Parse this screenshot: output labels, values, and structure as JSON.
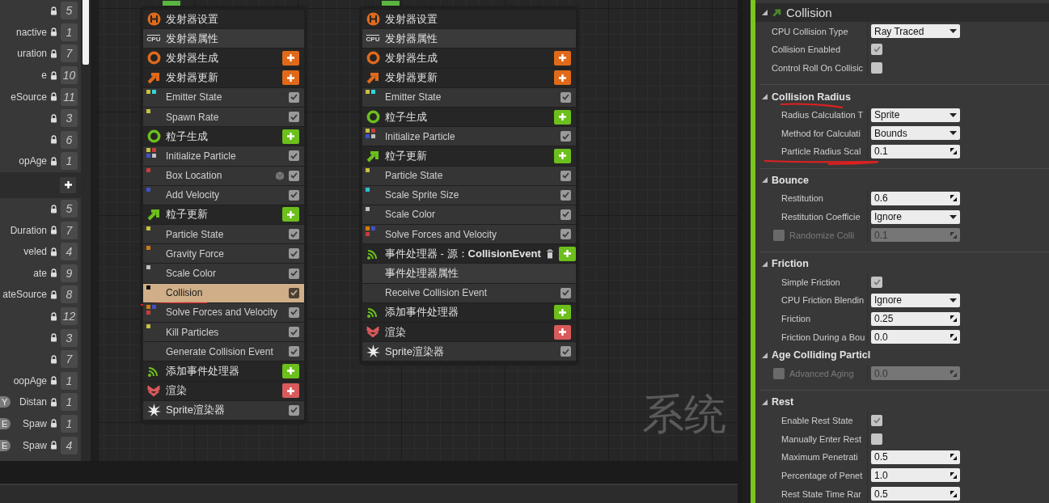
{
  "parameters": {
    "rows": [
      {
        "kind": "param",
        "count": "5"
      },
      {
        "kind": "param",
        "name": "nactive",
        "count": "1"
      },
      {
        "kind": "param",
        "name": "uration",
        "count": "7"
      },
      {
        "kind": "param",
        "name": "e",
        "count": "10"
      },
      {
        "kind": "param",
        "name": "eSource",
        "count": "11"
      },
      {
        "kind": "param",
        "count": "3"
      },
      {
        "kind": "param",
        "count": "6"
      },
      {
        "kind": "param",
        "name": "opAge",
        "count": "1"
      },
      {
        "kind": "header"
      },
      {
        "kind": "param",
        "count": "5"
      },
      {
        "kind": "param",
        "name": "Duration",
        "count": "7"
      },
      {
        "kind": "param",
        "name": "veled",
        "count": "4"
      },
      {
        "kind": "param",
        "name": "ate",
        "count": "9"
      },
      {
        "kind": "param",
        "name": "ateSource",
        "count": "8"
      },
      {
        "kind": "param",
        "count": "12"
      },
      {
        "kind": "param",
        "count": "3"
      },
      {
        "kind": "param",
        "count": "7"
      },
      {
        "kind": "param",
        "name": "oopAge",
        "count": "1"
      },
      {
        "kind": "param",
        "badge": "Y",
        "name": "Distan",
        "count": "1"
      },
      {
        "kind": "param",
        "badge": "E",
        "name": "Spaw",
        "count": "1"
      },
      {
        "kind": "param",
        "badge": "E",
        "name": "Spaw",
        "count": "4"
      }
    ]
  },
  "graph": {
    "label": "系统",
    "nodes": [
      {
        "items": [
          {
            "kind": "settings",
            "label": "发射器设置",
            "color": "#e06a1a",
            "add": false
          },
          {
            "kind": "props",
            "badge": "CPU",
            "label": "发射器属性"
          },
          {
            "kind": "spawn",
            "label": "发射器生成",
            "color": "#e06a1a",
            "add": true
          },
          {
            "kind": "update",
            "label": "发射器更新",
            "color": "#e06a1a",
            "add": true
          },
          {
            "kind": "module",
            "label": "Emitter State",
            "dots": [
              {
                "color": "#c8c040"
              },
              {
                "color": "#30d8d8"
              }
            ],
            "checked": true,
            "selected": false
          },
          {
            "kind": "module",
            "label": "Spawn Rate",
            "dots": [
              {
                "color": "#c8c040"
              }
            ],
            "checked": true,
            "selected": false
          },
          {
            "kind": "spawn",
            "label": "粒子生成",
            "color": "#6cbf1c",
            "add": true
          },
          {
            "kind": "module",
            "label": "Initialize Particle",
            "dots": [
              {
                "color": "#c8c040"
              },
              {
                "color": "#c83c3c"
              },
              {
                "color": "#4050c8"
              },
              {
                "color": "#c0c0c0"
              }
            ],
            "checked": true,
            "selected": false
          },
          {
            "kind": "module",
            "label": "Box Location",
            "dots": [
              {
                "color": "#c83c3c"
              }
            ],
            "checked": true,
            "selected": false,
            "cube": true
          },
          {
            "kind": "module",
            "label": "Add Velocity",
            "dots": [
              {
                "color": "#4050c8"
              }
            ],
            "checked": true,
            "selected": false
          },
          {
            "kind": "update",
            "label": "粒子更新",
            "color": "#6cbf1c",
            "add": true
          },
          {
            "kind": "module",
            "label": "Particle State",
            "dots": [
              {
                "color": "#c8c040"
              }
            ],
            "checked": true,
            "selected": false
          },
          {
            "kind": "module",
            "label": "Gravity Force",
            "dots": [
              {
                "color": "#d07a10"
              }
            ],
            "checked": true,
            "selected": false
          },
          {
            "kind": "module",
            "label": "Scale Color",
            "dots": [
              {
                "color": "#c0c0c0"
              }
            ],
            "checked": true,
            "selected": false
          },
          {
            "kind": "module",
            "label": "Collision",
            "dots": [
              {
                "color": "#101010"
              }
            ],
            "checked": true,
            "selected": true,
            "annotated": true
          },
          {
            "kind": "module",
            "label": "Solve Forces and Velocity",
            "dots": [
              {
                "color": "#d07a10"
              },
              {
                "color": "#4050c8"
              },
              {
                "color": "#c83c3c"
              }
            ],
            "checked": true,
            "selected": false
          },
          {
            "kind": "module",
            "label": "Kill Particles",
            "dots": [
              {
                "color": "#c8c040"
              }
            ],
            "checked": true,
            "selected": false
          },
          {
            "kind": "module",
            "label": "Generate Collision Event",
            "checked": true,
            "selected": false
          },
          {
            "kind": "events",
            "label": "添加事件处理器",
            "color": "#6cbf1c",
            "add": true
          },
          {
            "kind": "render",
            "label": "渲染",
            "color": "#d85a5a",
            "add": true
          },
          {
            "kind": "renderer",
            "label": "Sprite渲染器",
            "checked": true
          }
        ]
      },
      {
        "items": [
          {
            "kind": "settings",
            "label": "发射器设置",
            "color": "#e06a1a",
            "add": false
          },
          {
            "kind": "props",
            "badge": "CPU",
            "label": "发射器属性"
          },
          {
            "kind": "spawn",
            "label": "发射器生成",
            "color": "#e06a1a",
            "add": true
          },
          {
            "kind": "update",
            "label": "发射器更新",
            "color": "#e06a1a",
            "add": true
          },
          {
            "kind": "module",
            "label": "Emitter State",
            "dots": [
              {
                "color": "#c8c040"
              },
              {
                "color": "#30d8d8"
              }
            ],
            "checked": true,
            "selected": false
          },
          {
            "kind": "spawn",
            "label": "粒子生成",
            "color": "#6cbf1c",
            "add": true
          },
          {
            "kind": "module",
            "label": "Initialize Particle",
            "dots": [
              {
                "color": "#c8c040"
              },
              {
                "color": "#c83c3c"
              },
              {
                "color": "#4050c8"
              },
              {
                "color": "#c0c0c0"
              }
            ],
            "checked": true,
            "selected": false
          },
          {
            "kind": "update",
            "label": "粒子更新",
            "color": "#6cbf1c",
            "add": true
          },
          {
            "kind": "module",
            "label": "Particle State",
            "dots": [
              {
                "color": "#c8c040"
              }
            ],
            "checked": true,
            "selected": false
          },
          {
            "kind": "module",
            "label": "Scale Sprite Size",
            "dots": [
              {
                "color": "#30c0d0"
              }
            ],
            "checked": true,
            "selected": false
          },
          {
            "kind": "module",
            "label": "Scale Color",
            "dots": [
              {
                "color": "#c0c0c0"
              }
            ],
            "checked": true,
            "selected": false
          },
          {
            "kind": "module",
            "label": "Solve Forces and Velocity",
            "dots": [
              {
                "color": "#d07a10"
              },
              {
                "color": "#4050c8"
              },
              {
                "color": "#c83c3c"
              }
            ],
            "checked": true,
            "selected": false
          },
          {
            "kind": "events",
            "label": "事件处理器 - 源：**CollisionEvent**",
            "color": "#6cbf1c",
            "add": true,
            "delete": true
          },
          {
            "kind": "props",
            "label": "事件处理器属性"
          },
          {
            "kind": "module",
            "label": "Receive Collision Event",
            "checked": true,
            "selected": false
          },
          {
            "kind": "events",
            "label": "添加事件处理器",
            "color": "#6cbf1c",
            "add": true
          },
          {
            "kind": "render",
            "label": "渲染",
            "color": "#d85a5a",
            "add": true
          },
          {
            "kind": "renderer",
            "label": "Sprite渲染器",
            "checked": true
          }
        ]
      }
    ]
  },
  "details": {
    "title": "Collision",
    "sections": [
      {
        "rows": [
          {
            "kind": "dropdown",
            "label": "CPU Collision Type",
            "value": "Ray Traced"
          },
          {
            "kind": "checkbox",
            "label": "Collision Enabled",
            "checked": true
          },
          {
            "kind": "checkbox",
            "label": "Control Roll On Collisic",
            "checked": false
          }
        ]
      },
      {
        "title": "Collision Radius",
        "annotated": true,
        "rows": [
          {
            "kind": "dropdown",
            "label": "Radius Calculation T",
            "value": "Sprite"
          },
          {
            "kind": "dropdown",
            "label": "Method for Calculati",
            "value": "Bounds"
          },
          {
            "kind": "number",
            "label": "Particle Radius Scal",
            "value": "0.1",
            "annotated": true
          }
        ]
      },
      {
        "title": "Bounce",
        "rows": [
          {
            "kind": "number",
            "label": "Restitution",
            "value": "0.6"
          },
          {
            "kind": "dropdown",
            "label": "Restitution Coefficie",
            "value": "Ignore"
          },
          {
            "kind": "number",
            "label": "Randomize Colli",
            "value": "0.1",
            "disabled": true,
            "enabled_checked": false
          }
        ]
      },
      {
        "title": "Friction",
        "rows": [
          {
            "kind": "checkbox",
            "label": "Simple Friction",
            "checked": true
          },
          {
            "kind": "dropdown",
            "label": "CPU Friction Blendin",
            "value": "Ignore"
          },
          {
            "kind": "number",
            "label": "Friction",
            "value": "0.25"
          },
          {
            "kind": "number",
            "label": "Friction During a Bou",
            "value": "0.0"
          }
        ]
      },
      {
        "title": "Age Colliding Particl",
        "rows": [
          {
            "kind": "number",
            "label": "Advanced Aging",
            "value": "0.0",
            "disabled": true,
            "enabled_checked": false
          }
        ]
      },
      {
        "title": "Rest",
        "rows": [
          {
            "kind": "checkbox",
            "label": "Enable Rest State",
            "checked": true
          },
          {
            "kind": "checkbox",
            "label": "Manually Enter Rest",
            "checked": false
          },
          {
            "kind": "number",
            "label": "Maximum Penetrati",
            "value": "0.5"
          },
          {
            "kind": "number",
            "label": "Percentage of Penet",
            "value": "1.0"
          },
          {
            "kind": "number",
            "label": "Rest State Time Rar",
            "value": "0.5"
          }
        ]
      }
    ]
  }
}
